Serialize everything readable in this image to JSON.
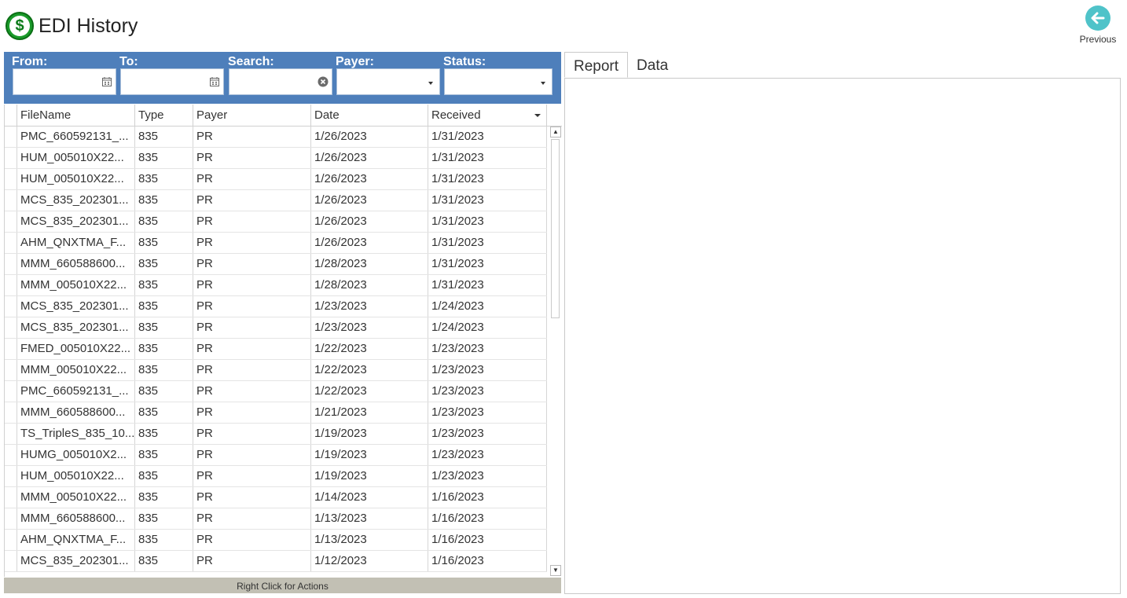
{
  "header": {
    "title": "EDI History",
    "logo_icon": "dollar-sign-icon",
    "previous_label": "Previous"
  },
  "filters": {
    "from": {
      "label": "From:",
      "value": ""
    },
    "to": {
      "label": "To:",
      "value": ""
    },
    "search": {
      "label": "Search:",
      "value": ""
    },
    "payer": {
      "label": "Payer:",
      "value": ""
    },
    "status": {
      "label": "Status:",
      "value": ""
    }
  },
  "grid": {
    "columns": [
      "FileName",
      "Type",
      "Payer",
      "Date",
      "Received"
    ],
    "sorted_column": "Received",
    "rows": [
      [
        "PMC_660592131_...",
        "835",
        "PR",
        "1/26/2023",
        "1/31/2023"
      ],
      [
        "HUM_005010X22...",
        "835",
        "PR",
        "1/26/2023",
        "1/31/2023"
      ],
      [
        "HUM_005010X22...",
        "835",
        "PR",
        "1/26/2023",
        "1/31/2023"
      ],
      [
        "MCS_835_202301...",
        "835",
        "PR",
        "1/26/2023",
        "1/31/2023"
      ],
      [
        "MCS_835_202301...",
        "835",
        "PR",
        "1/26/2023",
        "1/31/2023"
      ],
      [
        "AHM_QNXTMA_F...",
        "835",
        "PR",
        "1/26/2023",
        "1/31/2023"
      ],
      [
        "MMM_660588600...",
        "835",
        "PR",
        "1/28/2023",
        "1/31/2023"
      ],
      [
        "MMM_005010X22...",
        "835",
        "PR",
        "1/28/2023",
        "1/31/2023"
      ],
      [
        "MCS_835_202301...",
        "835",
        "PR",
        "1/23/2023",
        "1/24/2023"
      ],
      [
        "MCS_835_202301...",
        "835",
        "PR",
        "1/23/2023",
        "1/24/2023"
      ],
      [
        "FMED_005010X22...",
        "835",
        "PR",
        "1/22/2023",
        "1/23/2023"
      ],
      [
        "MMM_005010X22...",
        "835",
        "PR",
        "1/22/2023",
        "1/23/2023"
      ],
      [
        "PMC_660592131_...",
        "835",
        "PR",
        "1/22/2023",
        "1/23/2023"
      ],
      [
        "MMM_660588600...",
        "835",
        "PR",
        "1/21/2023",
        "1/23/2023"
      ],
      [
        "TS_TripleS_835_10...",
        "835",
        "PR",
        "1/19/2023",
        "1/23/2023"
      ],
      [
        "HUMG_005010X2...",
        "835",
        "PR",
        "1/19/2023",
        "1/23/2023"
      ],
      [
        "HUM_005010X22...",
        "835",
        "PR",
        "1/19/2023",
        "1/23/2023"
      ],
      [
        "MMM_005010X22...",
        "835",
        "PR",
        "1/14/2023",
        "1/16/2023"
      ],
      [
        "MMM_660588600...",
        "835",
        "PR",
        "1/13/2023",
        "1/16/2023"
      ],
      [
        "AHM_QNXTMA_F...",
        "835",
        "PR",
        "1/13/2023",
        "1/16/2023"
      ],
      [
        "MCS_835_202301...",
        "835",
        "PR",
        "1/12/2023",
        "1/16/2023"
      ]
    ]
  },
  "status_bar": "Right Click for Actions",
  "tabs": [
    {
      "label": "Report",
      "active": true
    },
    {
      "label": "Data",
      "active": false
    }
  ],
  "colors": {
    "filter_bar": "#4e7fbb",
    "logo": "#1a9a2a",
    "previous_icon": "#4fc3c9",
    "status_bar": "#c2c0b4"
  }
}
